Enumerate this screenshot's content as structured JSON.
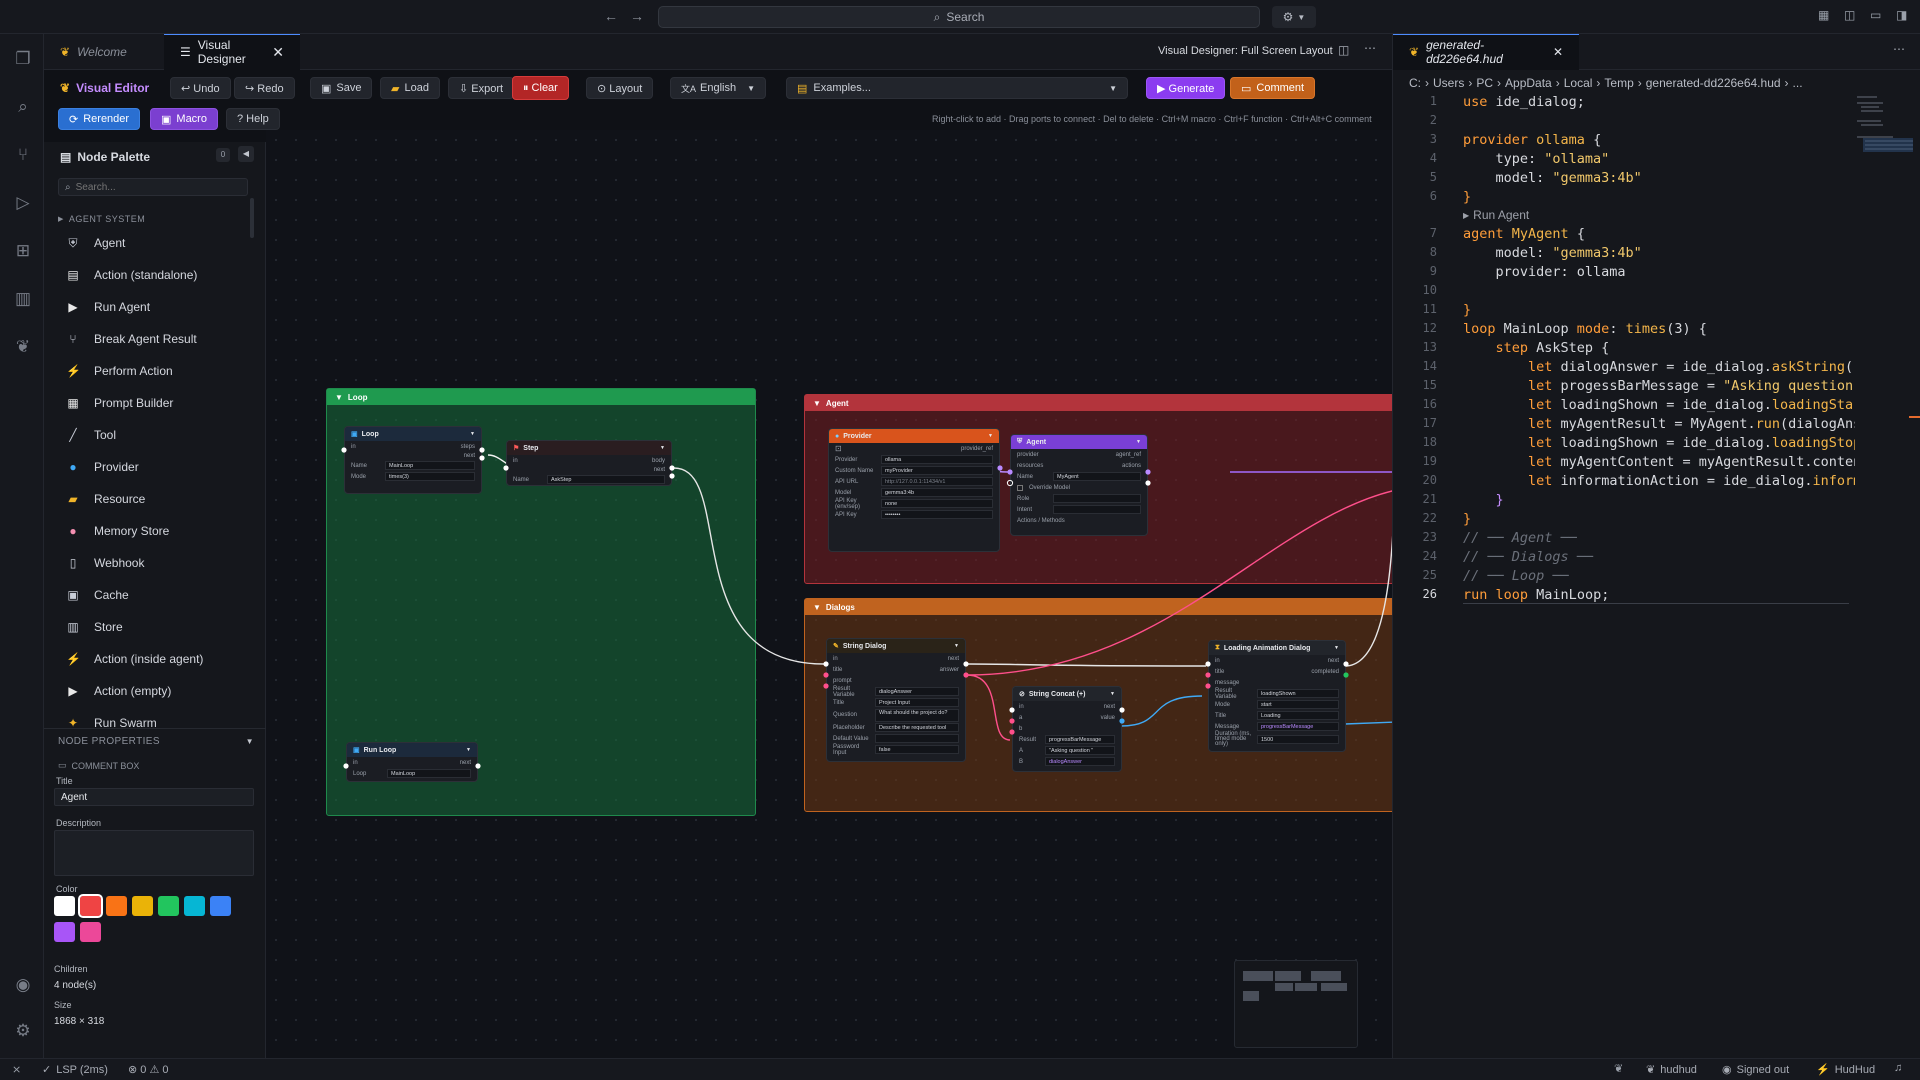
{
  "titlebar": {
    "search": "Search"
  },
  "tabs": [
    {
      "label": "Welcome"
    },
    {
      "label": "Visual Designer"
    },
    {
      "label": "generated-dd226e64.hud"
    }
  ],
  "designer_header": {
    "title": "Visual Designer: Full Screen Layout"
  },
  "toolbar": {
    "visual_editor": "Visual Editor",
    "undo": "↩ Undo",
    "redo": "↪ Redo",
    "save": "Save",
    "load": "Load",
    "export": "⇩ Export",
    "clear": "⏸ Clear",
    "layout": "⊙ Layout",
    "language": "English",
    "examples": "Examples...",
    "generate": "▶ Generate",
    "comment": "Comment",
    "rerender": "Rerender",
    "macro": "Macro",
    "help": "? Help",
    "hint": "Right-click to add · Drag ports to connect · Del to delete · Ctrl+M macro · Ctrl+F function · Ctrl+Alt+C comment"
  },
  "palette": {
    "title": "Node Palette",
    "count": "0",
    "search_placeholder": "Search...",
    "section": "AGENT SYSTEM",
    "items": [
      {
        "label": "Agent",
        "icon": "robot-icon",
        "glyph": "⛨",
        "color": "#c9ced8"
      },
      {
        "label": "Action (standalone)",
        "icon": "clipboard-icon",
        "glyph": "▤",
        "color": "#e8e8e8"
      },
      {
        "label": "Run Agent",
        "icon": "play-icon",
        "glyph": "▶",
        "color": "#e8e8e8"
      },
      {
        "label": "Break Agent Result",
        "icon": "split-icon",
        "glyph": "⑂",
        "color": "#c9ced8"
      },
      {
        "label": "Perform Action",
        "icon": "bolt-icon",
        "glyph": "⚡",
        "color": "#f5c518"
      },
      {
        "label": "Prompt Builder",
        "icon": "document-icon",
        "glyph": "▦",
        "color": "#e8e8e8"
      },
      {
        "label": "Tool",
        "icon": "wrench-icon",
        "glyph": "╱",
        "color": "#c9ced8"
      },
      {
        "label": "Provider",
        "icon": "globe-icon",
        "glyph": "●",
        "color": "#3fa9f5"
      },
      {
        "label": "Resource",
        "icon": "folder-icon",
        "glyph": "▰",
        "color": "#f0b429"
      },
      {
        "label": "Memory Store",
        "icon": "brain-icon",
        "glyph": "●",
        "color": "#f48fb1"
      },
      {
        "label": "Webhook",
        "icon": "webhook-icon",
        "glyph": "▯",
        "color": "#c9ced8"
      },
      {
        "label": "Cache",
        "icon": "cache-icon",
        "glyph": "▣",
        "color": "#c9ced8"
      },
      {
        "label": "Store",
        "icon": "store-icon",
        "glyph": "▥",
        "color": "#c9ced8"
      },
      {
        "label": "Action (inside agent)",
        "icon": "bolt-icon",
        "glyph": "⚡",
        "color": "#f5c518"
      },
      {
        "label": "Action (empty)",
        "icon": "play-icon",
        "glyph": "▶",
        "color": "#e8e8e8"
      },
      {
        "label": "Run Swarm",
        "icon": "swarm-icon",
        "glyph": "✦",
        "color": "#f0b429"
      }
    ]
  },
  "properties": {
    "title": "NODE PROPERTIES",
    "kind": "COMMENT BOX",
    "title_label": "Title",
    "title_value": "Agent",
    "description_label": "Description",
    "color_label": "Color",
    "colors": [
      "#ffffff",
      "#ef4444",
      "#f97316",
      "#eab308",
      "#22c55e",
      "#06b6d4",
      "#3b82f6",
      "#a855f7",
      "#ec4899"
    ],
    "children_label": "Children",
    "children_value": "4 node(s)",
    "size_label": "Size",
    "size_value": "1868 × 318"
  },
  "canvas": {
    "groups": {
      "loop": "Loop",
      "agent": "Agent",
      "dialogs": "Dialogs"
    },
    "loop_node": {
      "title": "Loop",
      "p_in": "in",
      "p_steps": "steps",
      "p_next": "next",
      "name_label": "Name",
      "name": "MainLoop",
      "mode_label": "Mode",
      "mode": "times(3)"
    },
    "step_node": {
      "title": "Step",
      "p_in": "in",
      "p_body": "body",
      "p_next": "next",
      "name_label": "Name",
      "name": "AskStep"
    },
    "run_loop_node": {
      "title": "Run Loop",
      "p_in": "in",
      "p_next": "next",
      "loop_label": "Loop",
      "loop": "MainLoop"
    },
    "provider_node": {
      "title": "Provider",
      "port": "provider_ref",
      "provider_label": "Provider",
      "provider": "ollama",
      "custom_label": "Custom Name",
      "custom": "myProvider",
      "url_label": "API URL",
      "url": "http://127.0.0.1:11434/v1",
      "model_label": "Model",
      "model": "gemma3:4b",
      "keysrc_label": "API Key (env/sep)",
      "keysrc": "none",
      "key_label": "API Key",
      "key": "••••••••"
    },
    "agent_node": {
      "title": "Agent",
      "p_provider": "provider",
      "p_resources": "resources",
      "p_agentref": "agent_ref",
      "p_actions": "actions",
      "name_label": "Name",
      "name": "MyAgent",
      "override_label": "Override Model",
      "role_label": "Role",
      "intent_label": "Intent",
      "actions_label": "Actions / Methods"
    },
    "string_dialog": {
      "title": "String Dialog",
      "p_in": "in",
      "p_title": "title",
      "p_prompt": "prompt",
      "p_next": "next",
      "p_answer": "answer",
      "result_label": "Result Variable",
      "result": "dialogAnswer",
      "title_label": "Title",
      "title_val": "Project Input",
      "question_label": "Question",
      "question": "What should the project do?",
      "placeholder_label": "Placeholder",
      "placeholder": "Describe the requested tool",
      "default_label": "Default Value",
      "password_label": "Password Input",
      "password": "false"
    },
    "string_concat": {
      "title": "String Concat (+)",
      "p_in": "in",
      "p_a": "a",
      "p_b": "b",
      "p_next": "next",
      "p_value": "value",
      "result_label": "Result",
      "result": "progressBarMessage",
      "a_label": "A",
      "a_val": "\"Asking question \"",
      "b_label": "B",
      "b_val": "dialogAnswer"
    },
    "loading_dialog": {
      "title": "Loading Animation Dialog",
      "p_in": "in",
      "p_title": "title",
      "p_message": "message",
      "p_next": "next",
      "p_completed": "completed",
      "result_label": "Result Variable",
      "result": "loadingShown",
      "mode_label": "Mode",
      "mode": "start",
      "title_label": "Title",
      "title_val": "Loading",
      "message_label": "Message",
      "message": "progressBarMessage",
      "duration_label": "Duration (ms, timed mode only)",
      "duration": "1500"
    }
  },
  "editor": {
    "breadcrumb": [
      "C:",
      "Users",
      "PC",
      "AppData",
      "Local",
      "Temp",
      "generated-dd226e64.hud",
      "..."
    ],
    "codelens": "Run Agent",
    "line_numbers": [
      "1",
      "2",
      "3",
      "4",
      "5",
      "6",
      "",
      "7",
      "8",
      "9",
      "10",
      "11",
      "12",
      "13",
      "14",
      "15",
      "16",
      "17",
      "18",
      "19",
      "20",
      "21",
      "22",
      "23",
      "24",
      "25",
      "26"
    ]
  },
  "status": {
    "lsp": "LSP (2ms)",
    "problems": "⊗ 0 ⚠ 0",
    "user": "hudhud",
    "signed": "Signed out",
    "brand": "HudHud"
  }
}
